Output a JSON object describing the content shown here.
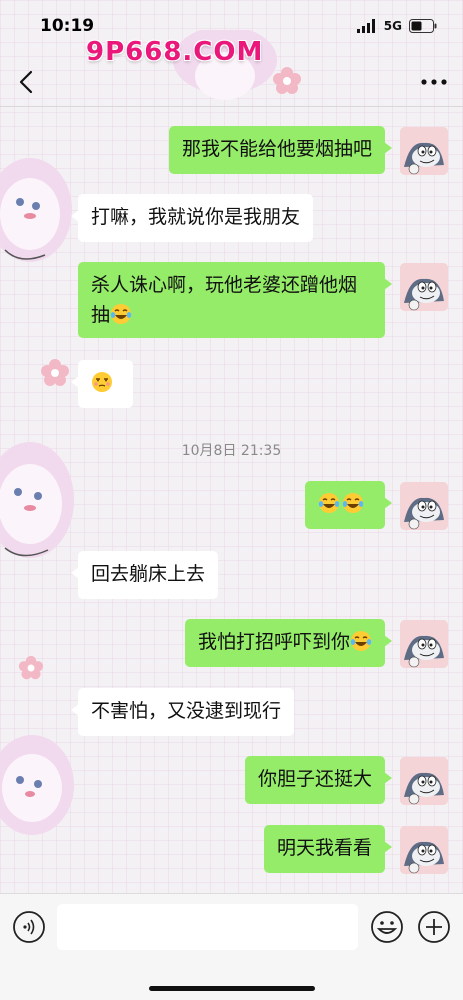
{
  "status_bar": {
    "time": "10:19",
    "carrier": "5G"
  },
  "watermark": "9P668.COM",
  "icons": {
    "back": "chevron-left-icon",
    "more": "more-dots-icon",
    "voice": "voice-input-icon",
    "emoji": "emoji-face-icon",
    "add": "plus-circle-icon"
  },
  "colors": {
    "outgoing_bubble": "#95ec69",
    "incoming_bubble": "#ffffff",
    "chat_bg": "#ededed"
  },
  "messages": [
    {
      "dir": "out",
      "text": "那我不能给他要烟抽吧"
    },
    {
      "dir": "in",
      "text": "打嘛，我就说你是我朋友"
    },
    {
      "dir": "out",
      "line1": "杀人诛心啊，玩他老婆还蹭他烟",
      "line2": "抽",
      "emoji": "laughing-tears"
    },
    {
      "dir": "in",
      "emoji": "unamused-face"
    },
    {
      "dir": "out",
      "emoji": "laughing-tears x2"
    },
    {
      "dir": "in",
      "text": "回去躺床上去"
    },
    {
      "dir": "out",
      "text": "我怕打招呼吓到你",
      "emoji": "laughing-tears"
    },
    {
      "dir": "in",
      "text": "不害怕，又没逮到现行"
    },
    {
      "dir": "out",
      "text": "你胆子还挺大"
    },
    {
      "dir": "out",
      "text": "明天我看看"
    }
  ],
  "timestamp": "10月8日 21:35"
}
